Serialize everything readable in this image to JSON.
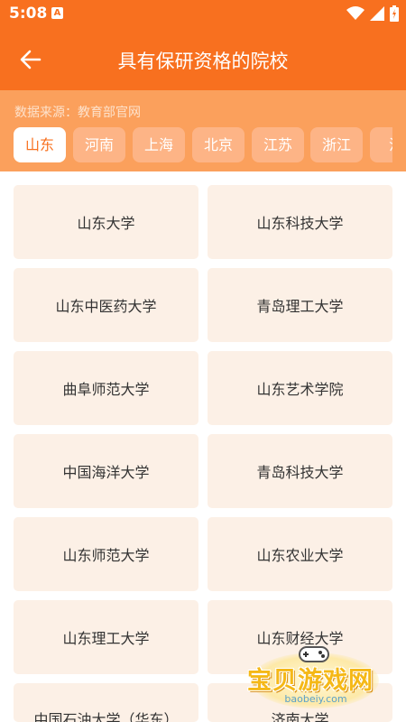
{
  "status": {
    "time": "5:08",
    "notification_letter": "A"
  },
  "appbar": {
    "title": "具有保研资格的院校"
  },
  "source_text": "数据来源：教育部官网",
  "provinces": [
    "山东",
    "河南",
    "上海",
    "北京",
    "江苏",
    "浙江",
    "江"
  ],
  "selected_province": "山东",
  "schools": [
    "山东大学",
    "山东科技大学",
    "山东中医药大学",
    "青岛理工大学",
    "曲阜师范大学",
    "山东艺术学院",
    "中国海洋大学",
    "青岛科技大学",
    "山东师范大学",
    "山东农业大学",
    "山东理工大学",
    "山东财经大学",
    "中国石油大学（华东）",
    "济南大学"
  ],
  "watermark": {
    "text": "宝贝游戏网",
    "url": "baobeiy.com"
  },
  "colors": {
    "primary": "#f8701f",
    "filter_bg": "#fba05c",
    "chip_bg": "#fdb486",
    "card_bg": "#fcf0e6"
  },
  "icons": {
    "back": "arrow-left-icon",
    "wifi": "wifi-icon",
    "signal": "signal-icon",
    "battery": "battery-icon"
  }
}
